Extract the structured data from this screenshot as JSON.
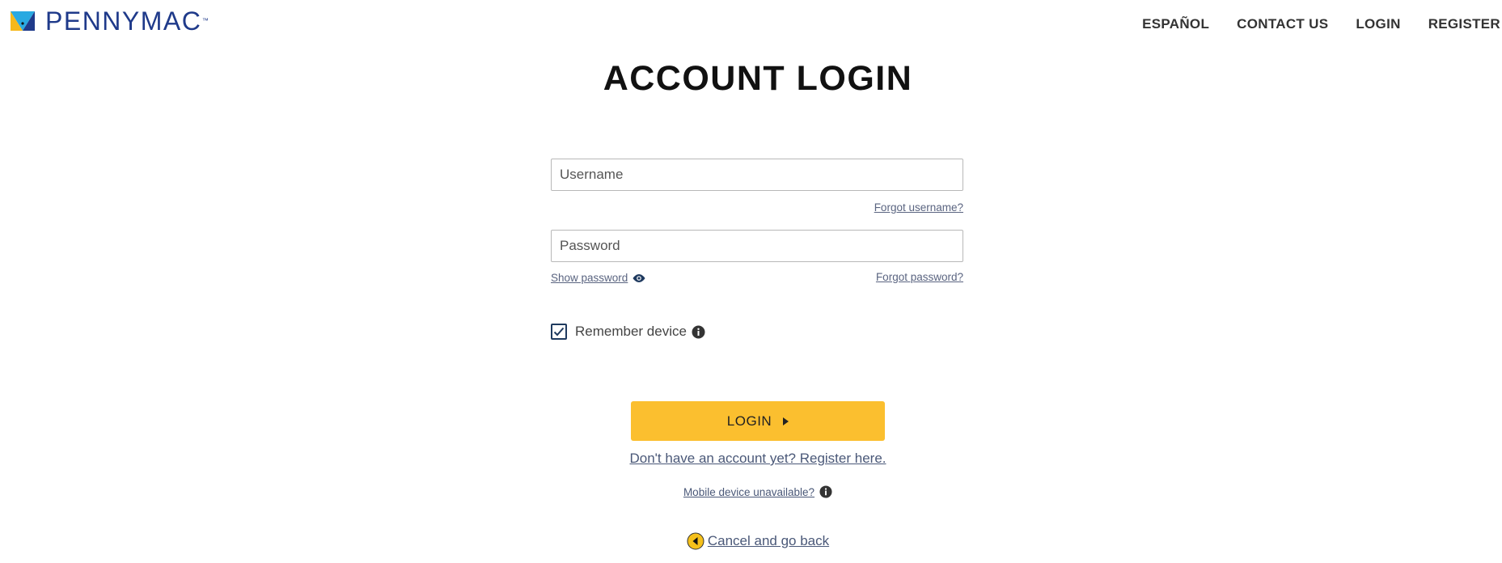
{
  "brand": {
    "name": "PENNYMAC",
    "tm": "™"
  },
  "nav": {
    "espanol": "ESPAÑOL",
    "contact": "CONTACT US",
    "login": "LOGIN",
    "register": "REGISTER"
  },
  "page": {
    "title": "ACCOUNT LOGIN"
  },
  "form": {
    "username_placeholder": "Username",
    "forgot_username": "Forgot username?",
    "password_placeholder": "Password",
    "show_password": "Show password",
    "forgot_password": "Forgot password?",
    "remember_label": "Remember device",
    "remember_checked": true,
    "login_button": "LOGIN",
    "register_link": "Don't have an account yet? Register here.",
    "mobile_unavailable": "Mobile device unavailable?",
    "cancel": "Cancel and go back"
  },
  "colors": {
    "brand_blue": "#1f3a8a",
    "accent_yellow": "#fbbf2f",
    "link": "#4a5878"
  },
  "icons": {
    "logo": "pennymac-logo-icon",
    "eye": "eye-icon",
    "info": "info-icon",
    "check": "checkmark-icon",
    "arrow": "caret-right-icon",
    "back": "back-arrow-icon"
  }
}
